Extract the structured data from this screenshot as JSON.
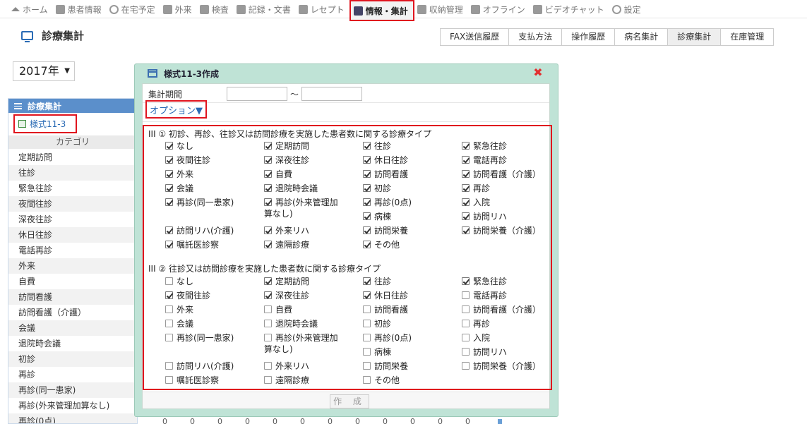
{
  "topnav": {
    "items": [
      {
        "label": "ホーム",
        "icon": "home-icon"
      },
      {
        "label": "患者情報",
        "icon": "patient-icon"
      },
      {
        "label": "在宅予定",
        "icon": "clock-icon"
      },
      {
        "label": "外来",
        "icon": "outpatient-icon"
      },
      {
        "label": "検査",
        "icon": "chart-icon"
      },
      {
        "label": "記録・文書",
        "icon": "document-icon"
      },
      {
        "label": "レセプト",
        "icon": "receipt-icon"
      },
      {
        "label": "情報・集計",
        "icon": "info-icon",
        "active": true
      },
      {
        "label": "収納管理",
        "icon": "payment-icon"
      },
      {
        "label": "オフライン",
        "icon": "offline-icon"
      },
      {
        "label": "ビデオチャット",
        "icon": "video-icon"
      },
      {
        "label": "設定",
        "icon": "gear-icon"
      }
    ]
  },
  "page": {
    "title": "診療集計"
  },
  "rtabs": [
    "FAX送信履歴",
    "支払方法",
    "操作履歴",
    "病名集計",
    "診療集計",
    "在庫管理"
  ],
  "year": {
    "value": "2017年"
  },
  "left": {
    "header": "診療集計",
    "form_link": "様式11-3",
    "category_header": "カテゴリ",
    "categories": [
      "定期訪問",
      "往診",
      "緊急往診",
      "夜間往診",
      "深夜往診",
      "休日往診",
      "電話再診",
      "外来",
      "自費",
      "訪問看護",
      "訪問看護（介護）",
      "会議",
      "退院時会議",
      "初診",
      "再診",
      "再診(同一患家)",
      "再診(外来管理加算なし)",
      "再診(0点)"
    ]
  },
  "bottom_zeros": [
    "0",
    "0",
    "0",
    "0",
    "0",
    "0",
    "0",
    "0",
    "0",
    "0",
    "0",
    "0"
  ],
  "modal": {
    "title": "様式11-3作成",
    "period_label": "集計期間",
    "period_from": "",
    "period_to": "",
    "tilde": "〜",
    "option_label": "オプション▼",
    "create_label": "作 成",
    "section1": {
      "title": "III ① 初診、再診、往診又は訪問診療を実施した患者数に関する診療タイプ",
      "items": [
        {
          "label": "なし",
          "checked": true
        },
        {
          "label": "定期訪問",
          "checked": true
        },
        {
          "label": "往診",
          "checked": true
        },
        {
          "label": "緊急往診",
          "checked": true
        },
        {
          "label": "夜間往診",
          "checked": true
        },
        {
          "label": "深夜往診",
          "checked": true
        },
        {
          "label": "休日往診",
          "checked": true
        },
        {
          "label": "電話再診",
          "checked": true
        },
        {
          "label": "外来",
          "checked": true
        },
        {
          "label": "自費",
          "checked": true
        },
        {
          "label": "訪問看護",
          "checked": true
        },
        {
          "label": "訪問看護（介護）",
          "checked": true
        },
        {
          "label": "会議",
          "checked": true
        },
        {
          "label": "退院時会議",
          "checked": true
        },
        {
          "label": "初診",
          "checked": true
        },
        {
          "label": "再診",
          "checked": true
        },
        {
          "label": "再診(同一患家)",
          "checked": true
        },
        {
          "label": "再診(外来管理加",
          "label2": "算なし)",
          "checked": true
        },
        {
          "label": "再診(0点)",
          "checked": true
        },
        {
          "label": "入院",
          "checked": true
        },
        {
          "label": "病棟",
          "checked": true
        },
        {
          "label": "訪問リハ",
          "checked": true
        },
        {
          "label": "訪問リハ(介護)",
          "checked": true
        },
        {
          "label": "外来リハ",
          "checked": true
        },
        {
          "label": "訪問栄養",
          "checked": true
        },
        {
          "label": "訪問栄養（介護）",
          "checked": true
        },
        {
          "label": "嘱託医診察",
          "checked": true
        },
        {
          "label": "遠隔診療",
          "checked": true
        },
        {
          "label": "その他",
          "checked": true
        }
      ]
    },
    "section2": {
      "title": "III ② 往診又は訪問診療を実施した患者数に関する診療タイプ",
      "items": [
        {
          "label": "なし",
          "checked": false
        },
        {
          "label": "定期訪問",
          "checked": true
        },
        {
          "label": "往診",
          "checked": true
        },
        {
          "label": "緊急往診",
          "checked": true
        },
        {
          "label": "夜間往診",
          "checked": true
        },
        {
          "label": "深夜往診",
          "checked": true
        },
        {
          "label": "休日往診",
          "checked": true
        },
        {
          "label": "電話再診",
          "checked": false
        },
        {
          "label": "外来",
          "checked": false
        },
        {
          "label": "自費",
          "checked": false
        },
        {
          "label": "訪問看護",
          "checked": false
        },
        {
          "label": "訪問看護（介護）",
          "checked": false
        },
        {
          "label": "会議",
          "checked": false
        },
        {
          "label": "退院時会議",
          "checked": false
        },
        {
          "label": "初診",
          "checked": false
        },
        {
          "label": "再診",
          "checked": false
        },
        {
          "label": "再診(同一患家)",
          "checked": false
        },
        {
          "label": "再診(外来管理加",
          "label2": "算なし)",
          "checked": false
        },
        {
          "label": "再診(0点)",
          "checked": false
        },
        {
          "label": "入院",
          "checked": false
        },
        {
          "label": "病棟",
          "checked": false
        },
        {
          "label": "訪問リハ",
          "checked": false
        },
        {
          "label": "訪問リハ(介護)",
          "checked": false
        },
        {
          "label": "外来リハ",
          "checked": false
        },
        {
          "label": "訪問栄養",
          "checked": false
        },
        {
          "label": "訪問栄養（介護）",
          "checked": false
        },
        {
          "label": "嘱託医診察",
          "checked": false
        },
        {
          "label": "遠隔診療",
          "checked": false
        },
        {
          "label": "その他",
          "checked": false
        }
      ]
    }
  }
}
